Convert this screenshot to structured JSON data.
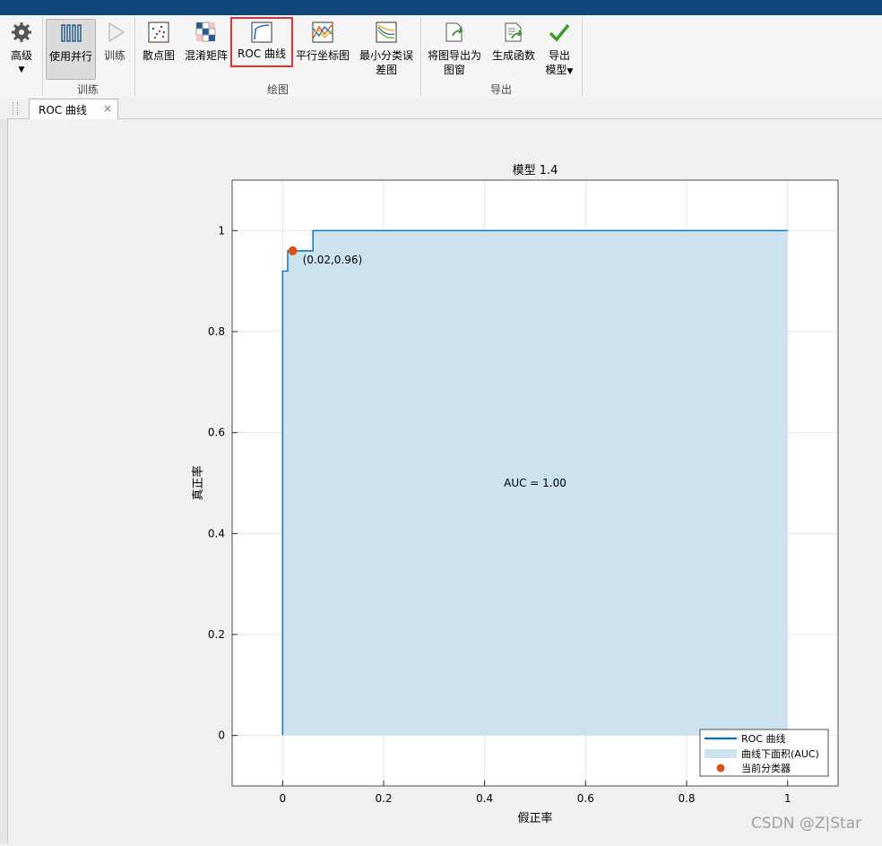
{
  "toolbar": {
    "buttons": [
      {
        "label": "高级",
        "icon": "gear-icon"
      },
      {
        "label": "使用并行",
        "icon": "parallel-icon"
      },
      {
        "label": "训练",
        "icon": "play-icon"
      },
      {
        "label": "散点图",
        "icon": "scatter-plot-icon"
      },
      {
        "label": "混淆矩阵",
        "icon": "confusion-matrix-icon"
      },
      {
        "label": "ROC 曲线",
        "icon": "roc-curve-icon"
      },
      {
        "label": "平行坐标图",
        "icon": "parallel-coordinates-icon"
      },
      {
        "label": "最小分类误",
        "label2": "差图",
        "icon": "min-classification-error-icon"
      },
      {
        "label": "将图导出为",
        "label2": "图窗",
        "icon": "export-figure-icon"
      },
      {
        "label": "生成函数",
        "icon": "generate-function-icon"
      },
      {
        "label": "导出",
        "label2": "模型",
        "icon": "export-model-icon"
      }
    ],
    "groups": {
      "train": "训练",
      "plot": "绘图",
      "export": "导出"
    }
  },
  "tab": {
    "title": "ROC 曲线",
    "close": "×"
  },
  "chart_data": {
    "type": "line",
    "title": "模型 1.4",
    "xlabel": "假正率",
    "ylabel": "真正率",
    "xlim": [
      -0.1,
      1.1
    ],
    "ylim": [
      -0.1,
      1.1
    ],
    "xticks": [
      "0",
      "0.2",
      "0.4",
      "0.6",
      "0.8",
      "1"
    ],
    "yticks": [
      "0",
      "0.2",
      "0.4",
      "0.6",
      "0.8",
      "1"
    ],
    "grid": true,
    "legend_position": "bottom-right",
    "series": [
      {
        "name": "ROC 曲线",
        "type": "line",
        "color": "#0072bd",
        "x": [
          0,
          0,
          0.01,
          0.01,
          0.02,
          0.02,
          0.04,
          0.06,
          0.06,
          1
        ],
        "y": [
          0,
          0.92,
          0.92,
          0.96,
          0.96,
          0.96,
          0.96,
          0.96,
          1,
          1
        ]
      },
      {
        "name": "曲线下面积(AUC)",
        "type": "area",
        "color": "#cde2ef"
      },
      {
        "name": "当前分类器",
        "type": "point",
        "color": "#d95319",
        "x": [
          0.02
        ],
        "y": [
          0.96
        ]
      }
    ],
    "point_label": "(0.02,0.96)",
    "auc_label": "AUC = 1.00"
  },
  "watermark": "CSDN @Z|Star"
}
